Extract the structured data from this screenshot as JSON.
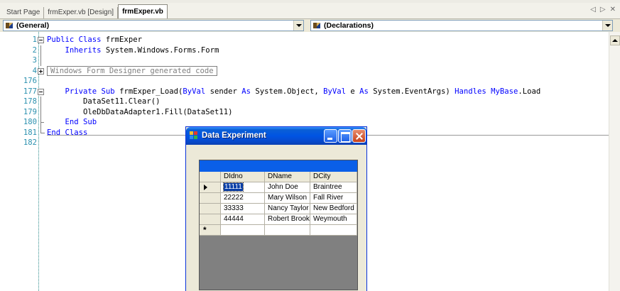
{
  "tabs": [
    {
      "label": "Start Page",
      "active": false
    },
    {
      "label": "frmExper.vb [Design]",
      "active": false
    },
    {
      "label": "frmExper.vb",
      "active": true
    }
  ],
  "tab_controls": {
    "prev": "◁",
    "next": "▷",
    "close": "✕"
  },
  "combos": {
    "object": "(General)",
    "procedure": "(Declarations)"
  },
  "code": {
    "lines": [
      {
        "num": "1",
        "parts": [
          {
            "t": "Public Class",
            "kw": true
          },
          {
            "t": " frmExper"
          }
        ]
      },
      {
        "num": "2",
        "parts": [
          {
            "t": "    "
          },
          {
            "t": "Inherits",
            "kw": true
          },
          {
            "t": " System.Windows.Forms.Form"
          }
        ]
      },
      {
        "num": "3",
        "parts": []
      },
      {
        "num": "4",
        "region": "Windows Form Designer generated code"
      },
      {
        "num": "176",
        "parts": []
      },
      {
        "num": "177",
        "parts": [
          {
            "t": "    "
          },
          {
            "t": "Private Sub",
            "kw": true
          },
          {
            "t": " frmExper_Load("
          },
          {
            "t": "ByVal",
            "kw": true
          },
          {
            "t": " sender "
          },
          {
            "t": "As",
            "kw": true
          },
          {
            "t": " System.Object, "
          },
          {
            "t": "ByVal",
            "kw": true
          },
          {
            "t": " e "
          },
          {
            "t": "As",
            "kw": true
          },
          {
            "t": " System.EventArgs) "
          },
          {
            "t": "Handles",
            "kw": true
          },
          {
            "t": " "
          },
          {
            "t": "MyBase",
            "kw": true
          },
          {
            "t": ".Load"
          }
        ]
      },
      {
        "num": "178",
        "parts": [
          {
            "t": "        DataSet11.Clear()"
          }
        ]
      },
      {
        "num": "179",
        "parts": [
          {
            "t": "        OleDbDataAdapter1.Fill(DataSet11)"
          }
        ]
      },
      {
        "num": "180",
        "parts": [
          {
            "t": "    "
          },
          {
            "t": "End Sub",
            "kw": true
          }
        ]
      },
      {
        "num": "181",
        "parts": [
          {
            "t": "End Class",
            "kw": true
          }
        ]
      },
      {
        "num": "182",
        "parts": []
      }
    ]
  },
  "form_window": {
    "title": "Data Experiment",
    "grid": {
      "columns": [
        "DIdno",
        "DName",
        "DCity"
      ],
      "rows": [
        [
          "11111",
          "John Doe",
          "Braintree"
        ],
        [
          "22222",
          "Mary Wilson",
          "Fall River"
        ],
        [
          "33333",
          "Nancy Taylor",
          "New Bedford"
        ],
        [
          "44444",
          "Robert Brook",
          "Weymouth"
        ]
      ],
      "new_row_marker": "*"
    }
  },
  "colors": {
    "keyword": "#0000ff",
    "line_number": "#2b91af",
    "titlebar": "#0054e3",
    "grid_caption": "#0a5fe8"
  }
}
